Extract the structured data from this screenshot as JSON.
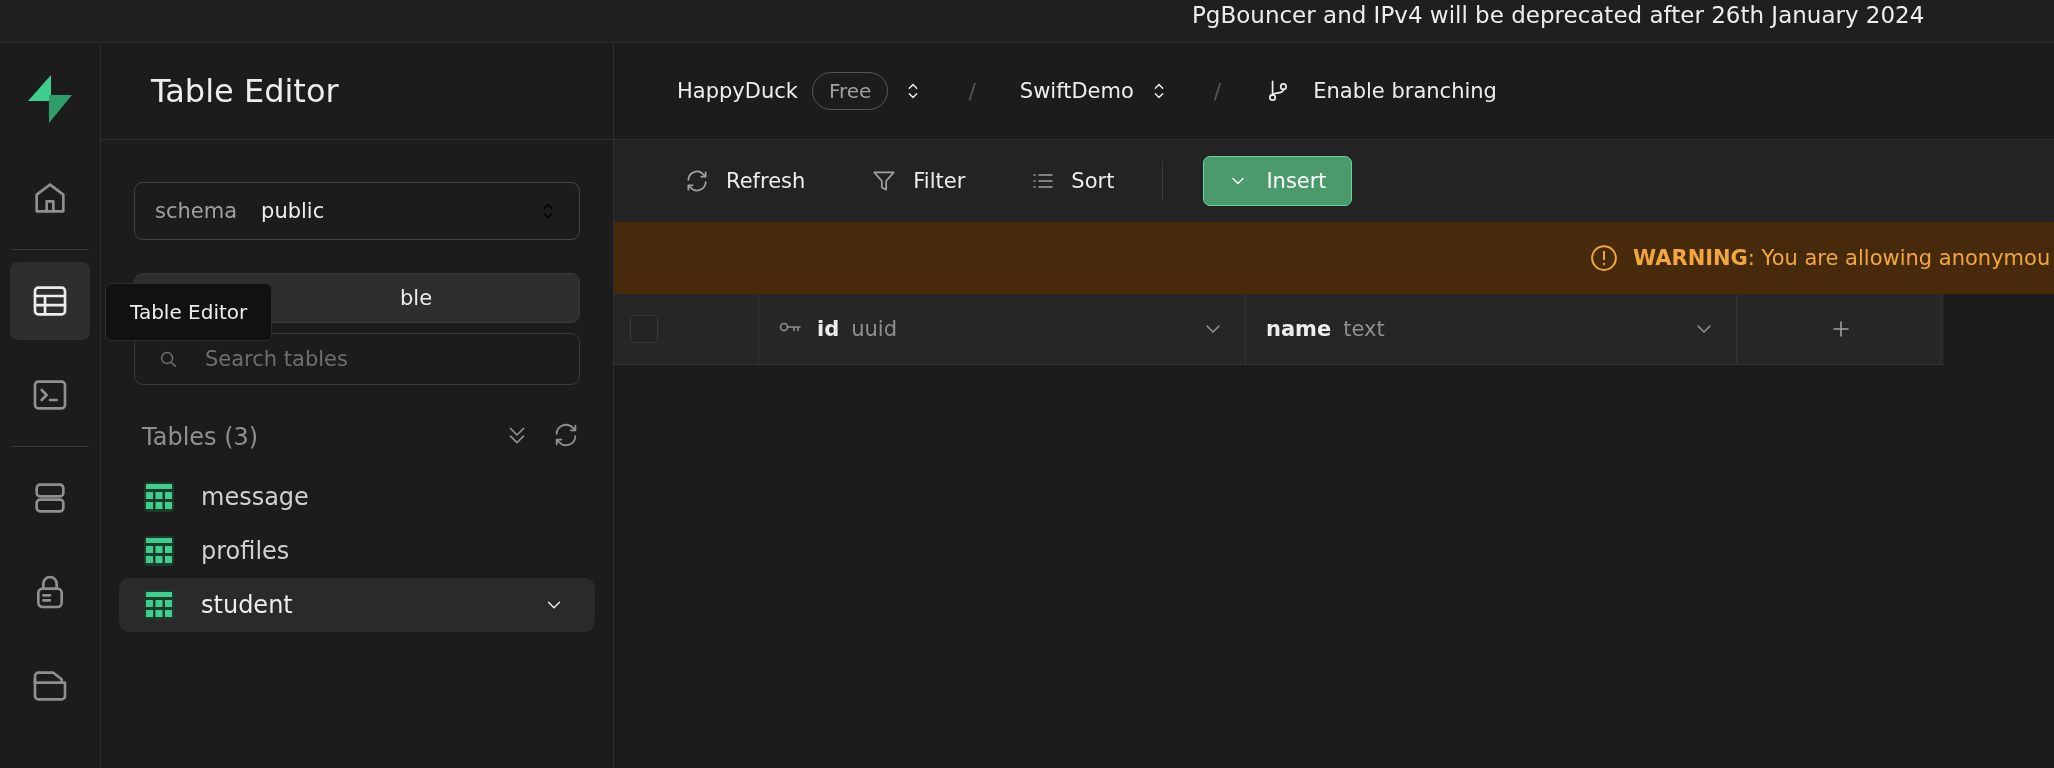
{
  "announcement": {
    "text": "PgBouncer and IPv4 will be deprecated after 26th January 2024"
  },
  "rail": {
    "items": [
      {
        "kind": "home",
        "selected": false
      },
      {
        "kind": "table",
        "selected": true
      },
      {
        "kind": "terminal",
        "selected": false
      },
      {
        "kind": "database",
        "selected": false
      },
      {
        "kind": "lock",
        "selected": false
      },
      {
        "kind": "folder",
        "selected": false
      }
    ],
    "tooltip": "Table Editor"
  },
  "panel": {
    "title": "Table Editor",
    "schema_label": "schema",
    "schema_value": "public",
    "new_table_button": "ble",
    "search": {
      "placeholder": "Search tables"
    },
    "tables_heading": "Tables (3)",
    "tables": [
      {
        "name": "message",
        "selected": false
      },
      {
        "name": "profiles",
        "selected": false
      },
      {
        "name": "student",
        "selected": true
      }
    ]
  },
  "breadcrumbs": {
    "separators": [
      "/",
      "/"
    ],
    "org": "HappyDuck",
    "plan": "Free",
    "project": "SwiftDemo",
    "branching": "Enable branching"
  },
  "toolbar": {
    "refresh": "Refresh",
    "filter": "Filter",
    "sort": "Sort",
    "insert": "Insert"
  },
  "warning": {
    "label": "WARNING",
    "text": ": You are allowing anonymou"
  },
  "table": {
    "select_all_checked": false,
    "columns": [
      {
        "name": "id",
        "type": "uuid",
        "primary_key": true
      },
      {
        "name": "name",
        "type": "text",
        "primary_key": false
      }
    ]
  }
}
